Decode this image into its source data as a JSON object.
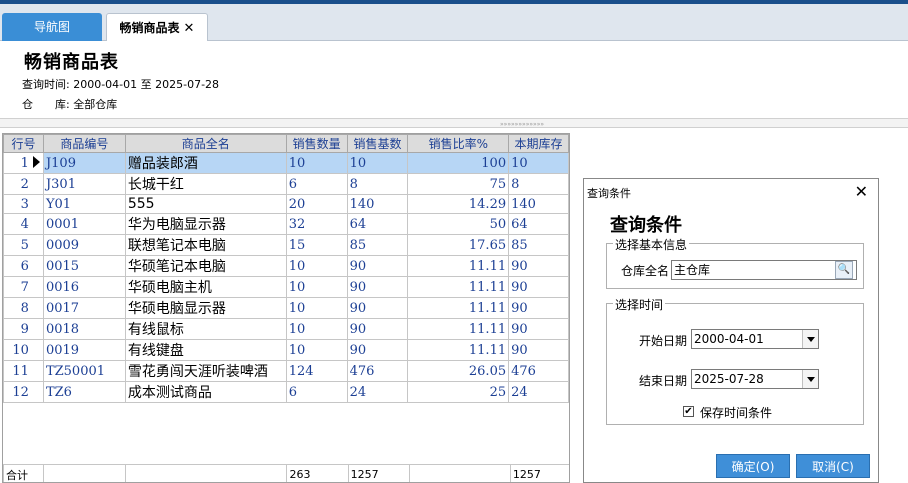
{
  "tabs": [
    {
      "label": "导航图"
    },
    {
      "label": "畅销商品表",
      "close": "✕"
    }
  ],
  "report": {
    "title": "畅销商品表",
    "query_time": "查询时间: 2000-04-01 至 2025-07-28",
    "warehouse": "仓　　库: 全部仓库"
  },
  "grid": {
    "headers": [
      "行号",
      "商品编号",
      "商品全名",
      "销售数量",
      "销售基数",
      "销售比率%",
      "本期库存"
    ],
    "rows": [
      [
        "1",
        "J109",
        "赠品装郎酒",
        "10",
        "10",
        "100",
        "10"
      ],
      [
        "2",
        "J301",
        "长城干红",
        "6",
        "8",
        "75",
        "8"
      ],
      [
        "3",
        "Y01",
        "555",
        "20",
        "140",
        "14.29",
        "140"
      ],
      [
        "4",
        "0001",
        "华为电脑显示器",
        "32",
        "64",
        "50",
        "64"
      ],
      [
        "5",
        "0009",
        "联想笔记本电脑",
        "15",
        "85",
        "17.65",
        "85"
      ],
      [
        "6",
        "0015",
        "华硕笔记本电脑",
        "10",
        "90",
        "11.11",
        "90"
      ],
      [
        "7",
        "0016",
        "华硕电脑主机",
        "10",
        "90",
        "11.11",
        "90"
      ],
      [
        "8",
        "0017",
        "华硕电脑显示器",
        "10",
        "90",
        "11.11",
        "90"
      ],
      [
        "9",
        "0018",
        "有线鼠标",
        "10",
        "90",
        "11.11",
        "90"
      ],
      [
        "10",
        "0019",
        "有线键盘",
        "10",
        "90",
        "11.11",
        "90"
      ],
      [
        "11",
        "TZ50001",
        "雪花勇闯天涯听装啤酒",
        "124",
        "476",
        "26.05",
        "476"
      ],
      [
        "12",
        "TZ6",
        "成本测试商品",
        "6",
        "24",
        "25",
        "24"
      ]
    ],
    "selected_row": 0,
    "total": {
      "label": "合计",
      "qty": "263",
      "base": "1257",
      "stock": "1257"
    }
  },
  "dialog": {
    "window_title": "查询条件",
    "heading": "查询条件",
    "basic_group": "选择基本信息",
    "warehouse_label": "仓库全名",
    "warehouse_value": "主仓库",
    "time_group": "选择时间",
    "start_label": "开始日期",
    "start_value": "2000-04-01",
    "end_label": "结束日期",
    "end_value": "2025-07-28",
    "save_time_label": "保存时间条件",
    "save_time_checked": "✔",
    "ok_label": "确定(O)",
    "cancel_label": "取消(C)"
  },
  "colors": {
    "accent": "#3f8fd8",
    "selected_row": "#b7d6f5",
    "header_bar": "#1a4f8b"
  }
}
